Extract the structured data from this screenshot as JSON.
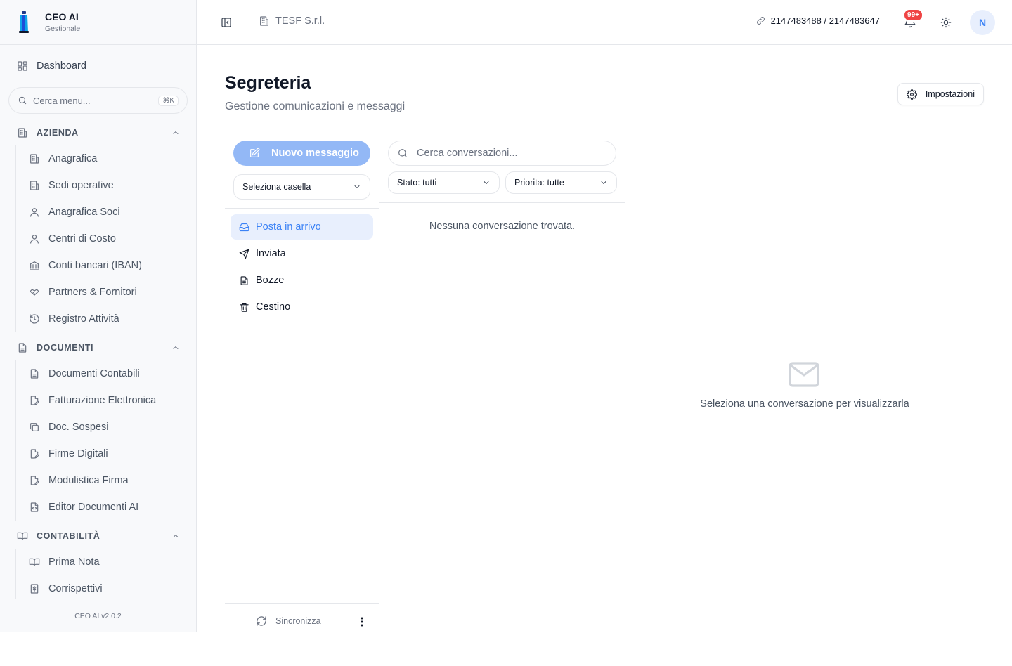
{
  "brand": {
    "title": "CEO AI",
    "subtitle": "Gestionale"
  },
  "sidebar": {
    "dashboard": "Dashboard",
    "search_placeholder": "Cerca menu...",
    "search_shortcut": "⌘K",
    "sections": [
      {
        "label": "AZIENDA",
        "items": [
          "Anagrafica",
          "Sedi operative",
          "Anagrafica Soci",
          "Centri di Costo",
          "Conti bancari (IBAN)",
          "Partners & Fornitori",
          "Registro Attività"
        ]
      },
      {
        "label": "DOCUMENTI",
        "items": [
          "Documenti Contabili",
          "Fatturazione Elettronica",
          "Doc. Sospesi",
          "Firme Digitali",
          "Modulistica Firma",
          "Editor Documenti AI"
        ]
      },
      {
        "label": "CONTABILITÀ",
        "items": [
          "Prima Nota",
          "Corrispettivi"
        ]
      }
    ],
    "version": "CEO AI v2.0.2"
  },
  "header": {
    "company": "TESF S.r.l.",
    "ids": "2147483488 / 2147483647",
    "notifications_badge": "99+",
    "avatar": "N"
  },
  "page": {
    "title": "Segreteria",
    "subtitle": "Gestione comunicazioni e messaggi",
    "settings_label": "Impostazioni"
  },
  "mail": {
    "new_message": "Nuovo messaggio",
    "mailbox_select": "Seleziona casella",
    "folders": [
      "Posta in arrivo",
      "Inviata",
      "Bozze",
      "Cestino"
    ],
    "active_folder": "Posta in arrivo",
    "sync_label": "Sincronizza",
    "search_placeholder": "Cerca conversazioni...",
    "filter_status": "Stato: tutti",
    "filter_priority": "Priorita: tutte",
    "empty_list": "Nessuna conversazione trovata.",
    "empty_detail": "Seleziona una conversazione per visualizzarla"
  },
  "colors": {
    "accent": "#3b82f6",
    "accent_light": "#93b8f6",
    "active_bg": "#e8effd",
    "badge": "#ef4444"
  }
}
